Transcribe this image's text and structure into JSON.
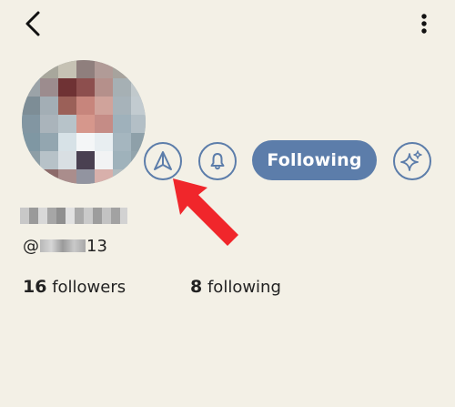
{
  "topbar": {
    "back_icon": "arrow-left-icon",
    "more_icon": "vertical-dots-icon"
  },
  "profile": {
    "username_prefix": "@",
    "username_suffix": "13"
  },
  "actions": {
    "share_icon": "paper-plane-icon",
    "bell_icon": "bell-icon",
    "follow_label": "Following",
    "sparkle_icon": "sparkles-icon"
  },
  "stats": {
    "followers_count": "16",
    "followers_label": "followers",
    "following_count": "8",
    "following_label": "following"
  },
  "colors": {
    "background": "#f3f0e6",
    "accent": "#5c7daa",
    "annotation_arrow": "#f0262b"
  }
}
